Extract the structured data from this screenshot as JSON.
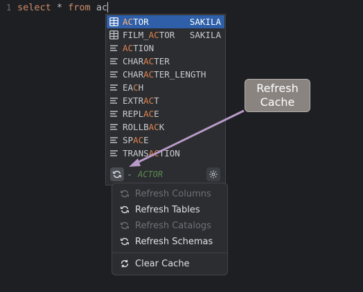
{
  "editor": {
    "line_number": "1",
    "code": {
      "kw1": "select",
      "mid": " * ",
      "kw2": "from",
      "end": " ac"
    }
  },
  "completion": {
    "items": [
      {
        "pre": "",
        "hl": "AC",
        "post": "TOR",
        "tail": "SAKILA",
        "icon": "table-icon",
        "selected": true
      },
      {
        "pre": "FILM_",
        "hl": "AC",
        "post": "TOR",
        "tail": "SAKILA",
        "icon": "table-icon"
      },
      {
        "pre": "",
        "hl": "AC",
        "post": "TION",
        "tail": "",
        "icon": "keyword-icon"
      },
      {
        "pre": "CHAR",
        "hl": "AC",
        "post": "TER",
        "tail": "",
        "icon": "keyword-icon"
      },
      {
        "pre": "CHAR",
        "hl": "AC",
        "post": "TER_LENGTH",
        "tail": "",
        "icon": "keyword-icon"
      },
      {
        "pre": "EA",
        "hl": "C",
        "post": "H",
        "tail": "",
        "icon": "keyword-icon"
      },
      {
        "pre": "EXTR",
        "hl": "AC",
        "post": "T",
        "tail": "",
        "icon": "keyword-icon"
      },
      {
        "pre": "REPL",
        "hl": "AC",
        "post": "E",
        "tail": "",
        "icon": "keyword-icon"
      },
      {
        "pre": "ROLLB",
        "hl": "AC",
        "post": "K",
        "tail": "",
        "icon": "keyword-icon"
      },
      {
        "pre": "SP",
        "hl": "AC",
        "post": "E",
        "tail": "",
        "icon": "keyword-icon"
      },
      {
        "pre": "TRANS",
        "hl": "AC",
        "post": "TION",
        "tail": "",
        "icon": "keyword-icon"
      }
    ],
    "footer_hint": "ACTOR",
    "caret_glyph": "⌄"
  },
  "menu": {
    "items": [
      {
        "label": "Refresh Columns",
        "enabled": false,
        "icon": "refresh-icon"
      },
      {
        "label": "Refresh Tables",
        "enabled": true,
        "icon": "refresh-icon"
      },
      {
        "label": "Refresh Catalogs",
        "enabled": false,
        "icon": "refresh-icon"
      },
      {
        "label": "Refresh Schemas",
        "enabled": true,
        "icon": "refresh-icon"
      },
      {
        "label": "Clear Cache",
        "enabled": true,
        "icon": "clear-cache-icon"
      }
    ]
  },
  "callout": {
    "line1": "Refresh",
    "line2": "Cache"
  },
  "colors": {
    "background": "#1e1f22",
    "popup": "#2b2d30",
    "selection": "#2e5fa8",
    "match_highlight": "#e0834f",
    "keyword": "#cf8e6d",
    "hint": "#5d8a52",
    "callout": "#8a8480",
    "arrow": "#b99ac9"
  }
}
